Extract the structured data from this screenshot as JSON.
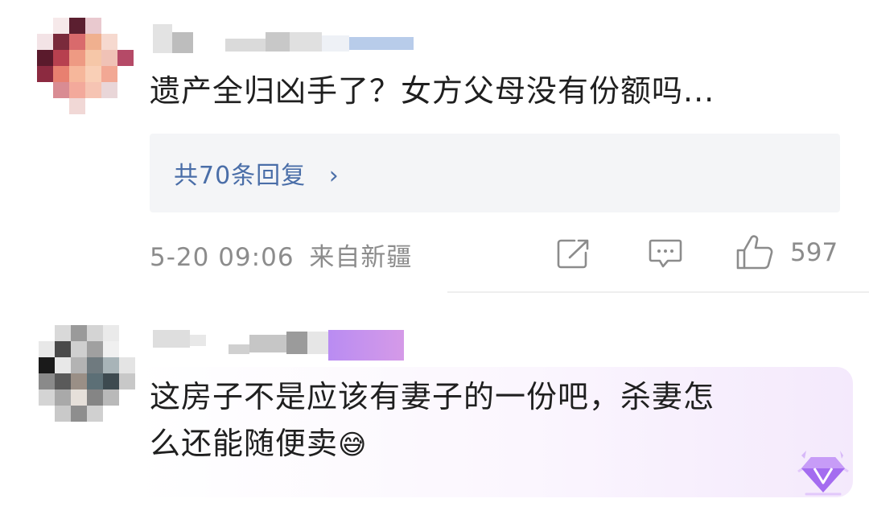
{
  "comments": [
    {
      "text": "遗产全归凶手了？女方父母没有份额吗...",
      "replies_label": "共70条回复",
      "replies_chevron": "›",
      "timestamp": "5-20 09:06",
      "location": "来自新疆",
      "likes": "597",
      "icons": [
        "share-icon",
        "comment-icon",
        "thumbs-up-icon"
      ]
    },
    {
      "text_line1": "这房子不是应该有妻子的一份吧，杀妻怎",
      "text_line2": "么还能随便卖",
      "emoji": "😅",
      "badge_icon": "gem-badge-icon"
    }
  ],
  "colors": {
    "text": "#1f1f1f",
    "meta": "#8c8c8c",
    "link": "#4a6ea8",
    "reply_bg": "#f4f5f7",
    "bubble_accent": "#f4e9fc",
    "badge": "#a46cf0"
  }
}
